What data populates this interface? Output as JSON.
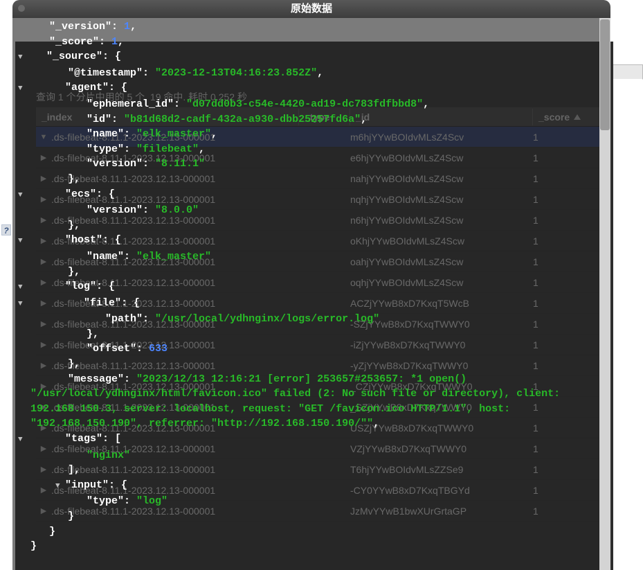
{
  "modal": {
    "title": "原始数据"
  },
  "status": "查询 1 个分片中用的 5 个. 19 命中. 耗时 0.252 秒",
  "columns": {
    "index": "_index",
    "type": "_type",
    "id": "_id",
    "score": "_score"
  },
  "rows": [
    {
      "index": ".ds-filebeat-8.11.1-2023.12.13-000001",
      "id": "m6hjYYwBOIdvMLsZ4Scv",
      "score": "1",
      "selected": true,
      "open": true
    },
    {
      "index": ".ds-filebeat-8.11.1-2023.12.13-000001",
      "id": "e6hjYYwBOIdvMLsZ4Scw",
      "score": "1"
    },
    {
      "index": ".ds-filebeat-8.11.1-2023.12.13-000001",
      "id": "nahjYYwBOIdvMLsZ4Scw",
      "score": "1"
    },
    {
      "index": ".ds-filebeat-8.11.1-2023.12.13-000001",
      "id": "nqhjYYwBOIdvMLsZ4Scw",
      "score": "1"
    },
    {
      "index": ".ds-filebeat-8.11.1-2023.12.13-000001",
      "id": "n6hjYYwBOIdvMLsZ4Scw",
      "score": "1"
    },
    {
      "index": ".ds-filebeat-8.11.1-2023.12.13-000001",
      "id": "oKhjYYwBOIdvMLsZ4Scw",
      "score": "1"
    },
    {
      "index": ".ds-filebeat-8.11.1-2023.12.13-000001",
      "id": "oahjYYwBOIdvMLsZ4Scw",
      "score": "1"
    },
    {
      "index": ".ds-filebeat-8.11.1-2023.12.13-000001",
      "id": "oqhjYYwBOIdvMLsZ4Scw",
      "score": "1"
    },
    {
      "index": ".ds-filebeat-8.11.1-2023.12.13-000001",
      "id": "ACZjYYwB8xD7KxqT5WcB",
      "score": "1"
    },
    {
      "index": ".ds-filebeat-8.11.1-2023.12.13-000001",
      "id": "-SZjYYwB8xD7KxqTWWY0",
      "score": "1"
    },
    {
      "index": ".ds-filebeat-8.11.1-2023.12.13-000001",
      "id": "-iZjYYwB8xD7KxqTWWY0",
      "score": "1"
    },
    {
      "index": ".ds-filebeat-8.11.1-2023.12.13-000001",
      "id": "-yZjYYwB8xD7KxqTWWY0",
      "score": "1"
    },
    {
      "index": ".ds-filebeat-8.11.1-2023.12.13-000001",
      "id": "_CZjYYwB8xD7KxqTWWY0",
      "score": "1"
    },
    {
      "index": ".ds-filebeat-8.11.1-2023.12.13-000001",
      "id": "_SZjYYwB8xD7KxqTWWY0",
      "score": "1"
    },
    {
      "index": ".ds-filebeat-8.11.1-2023.12.13-000001",
      "id": "USZjYYwB8xD7KxqTWWY0",
      "score": "1"
    },
    {
      "index": ".ds-filebeat-8.11.1-2023.12.13-000001",
      "id": "VZjYYwB8xD7KxqTWWY0",
      "score": "1"
    },
    {
      "index": ".ds-filebeat-8.11.1-2023.12.13-000001",
      "id": "T6hjYYwBOIdvMLsZZSe9",
      "score": "1"
    },
    {
      "index": ".ds-filebeat-8.11.1-2023.12.13-000001",
      "id": "-CY0YYwB8xD7KxqTBGYd",
      "score": "1"
    },
    {
      "index": ".ds-filebeat-8.11.1-2023.12.13-000001",
      "id": "JzMvYYwB1bwXUrGrtaGP",
      "score": "1"
    }
  ],
  "json": {
    "_version": "1",
    "_score": "1",
    "source_key": "\"_source\": {",
    "timestamp_key": "\"@timestamp\": ",
    "timestamp_val": "\"2023-12-13T04:16:23.852Z\"",
    "agent_key": "\"agent\": {",
    "ephemeral_id_key": "\"ephemeral_id\": ",
    "ephemeral_id_val": "\"d07dd0b3-c54e-4420-ad19-dc783fdfbbd8\"",
    "id_key": "\"id\": ",
    "id_val": "\"b81d68d2-cadf-432a-a930-dbb25257fd6a\"",
    "name_key": "\"name\": ",
    "name_val": "\"elk_master\"",
    "type_key": "\"type\": ",
    "type_val": "\"filebeat\"",
    "version_key": "\"version\": ",
    "version_val": "\"8.11.1\"",
    "ecs_key": "\"ecs\": {",
    "ecs_version_val": "\"8.0.0\"",
    "host_key": "\"host\": {",
    "host_name_val": "\"elk_master\"",
    "log_key": "\"log\": {",
    "file_key": "\"file\": {",
    "path_key": "\"path\": ",
    "path_val": "\"/usr/local/ydhnginx/logs/error.log\"",
    "offset_key": "\"offset\": ",
    "offset_val": "633",
    "message_key": "\"message\": ",
    "message_val": "\"2023/12/13 12:16:21 [error] 253657#253657: *1 open()\n\"/usr/local/ydhnginx/html/favicon.ico\" failed (2: No such file or directory), client:\n192.168.150.3, server: localhost, request: \"GET /favicon.ico HTTP/1.1\", host:\n\"192.168.150.190\", referrer: \"http://192.168.150.190/\"\"",
    "tags_key": "\"tags\": [",
    "tags_val": "\"nginx\"",
    "input_key": "\"input\": {",
    "input_type_val": "\"log\""
  },
  "help": "?"
}
